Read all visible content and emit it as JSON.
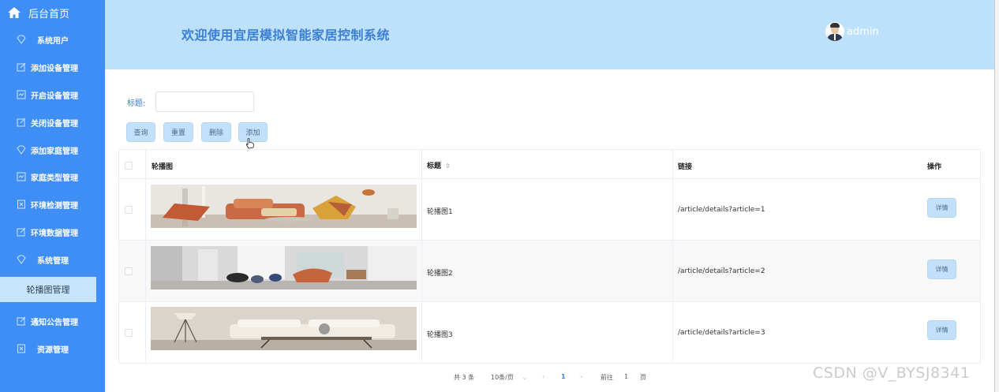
{
  "sidebar": {
    "home_label": "后台首页",
    "items": [
      {
        "label": "系统用户",
        "icon": "diamond-icon"
      },
      {
        "label": "添加设备管理",
        "icon": "edit-icon"
      },
      {
        "label": "开启设备管理",
        "icon": "chart-icon"
      },
      {
        "label": "关闭设备管理",
        "icon": "edit-icon"
      },
      {
        "label": "添加家庭管理",
        "icon": "diamond-icon"
      },
      {
        "label": "家庭类型管理",
        "icon": "chart-icon"
      },
      {
        "label": "环境检测管理",
        "icon": "document-icon"
      },
      {
        "label": "环境数据管理",
        "icon": "edit-icon"
      },
      {
        "label": "系统管理",
        "icon": "diamond-icon"
      }
    ],
    "active_label": "轮播图管理",
    "items_after": [
      {
        "label": "通知公告管理",
        "icon": "edit-icon"
      },
      {
        "label": "资源管理",
        "icon": "document-icon"
      }
    ]
  },
  "header": {
    "title": "欢迎使用宜居模拟智能家居控制系统",
    "username": "admin"
  },
  "search": {
    "title_label": "标题:",
    "title_value": ""
  },
  "toolbar": {
    "query": "查询",
    "reset": "重置",
    "delete": "删除",
    "add": "添加"
  },
  "table": {
    "columns": [
      "轮播图",
      "标题",
      "链接",
      "操作"
    ],
    "sort_icon": "⇕",
    "rows": [
      {
        "title": "轮播图1",
        "link": "/article/details?article=1",
        "action": "详情"
      },
      {
        "title": "轮播图2",
        "link": "/article/details?article=2",
        "action": "详情"
      },
      {
        "title": "轮播图3",
        "link": "/article/details?article=3",
        "action": "详情"
      }
    ]
  },
  "pagination": {
    "total": "共 3 条",
    "page_size": "10条/页",
    "prev": "‹",
    "current": "1",
    "next": "›",
    "goto_label": "前往",
    "goto_value": "1",
    "page_label": "页"
  },
  "watermark": "CSDN @V_BYSJ8341",
  "colors": {
    "sidebar": "#3f8ef5",
    "header": "#bde0fb",
    "accent": "#3b7fd6",
    "button": "#c2e0fa"
  }
}
